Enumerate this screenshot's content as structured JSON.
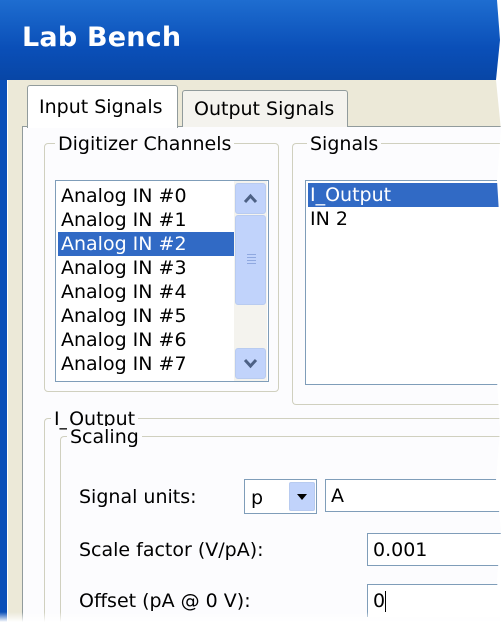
{
  "window": {
    "title": "Lab Bench"
  },
  "tabs": [
    {
      "label": "Input Signals",
      "selected": true
    },
    {
      "label": "Output Signals",
      "selected": false
    }
  ],
  "digitizer": {
    "title": "Digitizer Channels",
    "channels": [
      "Analog IN #0",
      "Analog IN #1",
      "Analog IN #2",
      "Analog IN #3",
      "Analog IN #4",
      "Analog IN #5",
      "Analog IN #6",
      "Analog IN #7"
    ],
    "selected_index": 2
  },
  "signals": {
    "title": "Signals",
    "items": [
      "I_Output",
      "IN 2"
    ],
    "selected_index": 0
  },
  "signal_group": {
    "title": "I_Output",
    "scaling": {
      "title": "Scaling",
      "units_label": "Signal units:",
      "prefix_value": "p",
      "units_value": "A",
      "scale_label": "Scale factor (V/pA):",
      "scale_value": "0.001",
      "offset_label": "Offset (pA @ 0 V):",
      "offset_value": "0"
    }
  },
  "colors": {
    "title_bar": "#0a4fb8",
    "selection": "#316ac5",
    "panel_bg": "#ece9d8"
  }
}
